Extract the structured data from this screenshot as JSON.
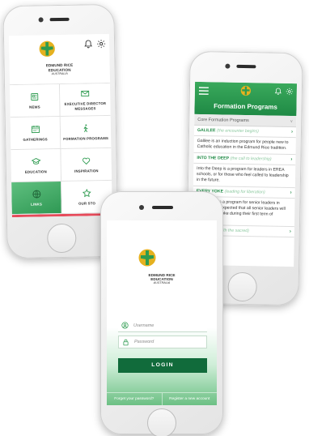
{
  "brand": {
    "name": "EDMUND RICE EDUCATION",
    "sub": "AUSTRALIA"
  },
  "home": {
    "menu": [
      {
        "label": "NEWS",
        "icon": "newspaper-icon"
      },
      {
        "label": "EXECUTIVE DIRECTOR MESSAGES",
        "icon": "envelope-icon"
      },
      {
        "label": "GATHERINGS",
        "icon": "calendar-icon"
      },
      {
        "label": "FORMATION PROGRAMS",
        "icon": "walking-person-icon"
      },
      {
        "label": "EDUCATION",
        "icon": "graduation-cap-icon"
      },
      {
        "label": "INSPIRATION",
        "icon": "heart-icon"
      },
      {
        "label": "LINKS",
        "icon": "globe-icon"
      },
      {
        "label": "OUR STO",
        "icon": "star-icon"
      }
    ]
  },
  "login": {
    "username_placeholder": "Username",
    "password_placeholder": "Password",
    "login_label": "LOGIN",
    "forgot_label": "Forget your password?",
    "register_label": "Register a new account"
  },
  "formation": {
    "title": "Formation Programs",
    "dropdown": "Core Formation Programs",
    "items": [
      {
        "name": "GALILEE",
        "tagline": "(the encounter begins)",
        "desc": "Galilee is an induction program for people new to Catholic education in the Edmund Rice tradition."
      },
      {
        "name": "INTO THE DEEP",
        "tagline": "(the call to leadership)",
        "desc": "Into the Deep is a program for leaders in EREA schools, or for those who feel called to leadership in the future."
      },
      {
        "name": "EVERY YOKE",
        "tagline": "(leading for liberation)",
        "desc": "Every Yoke is a program for senior leaders in schools (it is expected that all senior leaders will break Every Yoke during their first term of leadership)."
      },
      {
        "name": "",
        "tagline": "(Encounters with the sacred)",
        "desc": ""
      }
    ]
  },
  "colors": {
    "brand_green": "#1f8a45",
    "dark_green": "#116b3b",
    "logo_gold": "#e5b11f",
    "accent_red": "#e64a5a"
  }
}
